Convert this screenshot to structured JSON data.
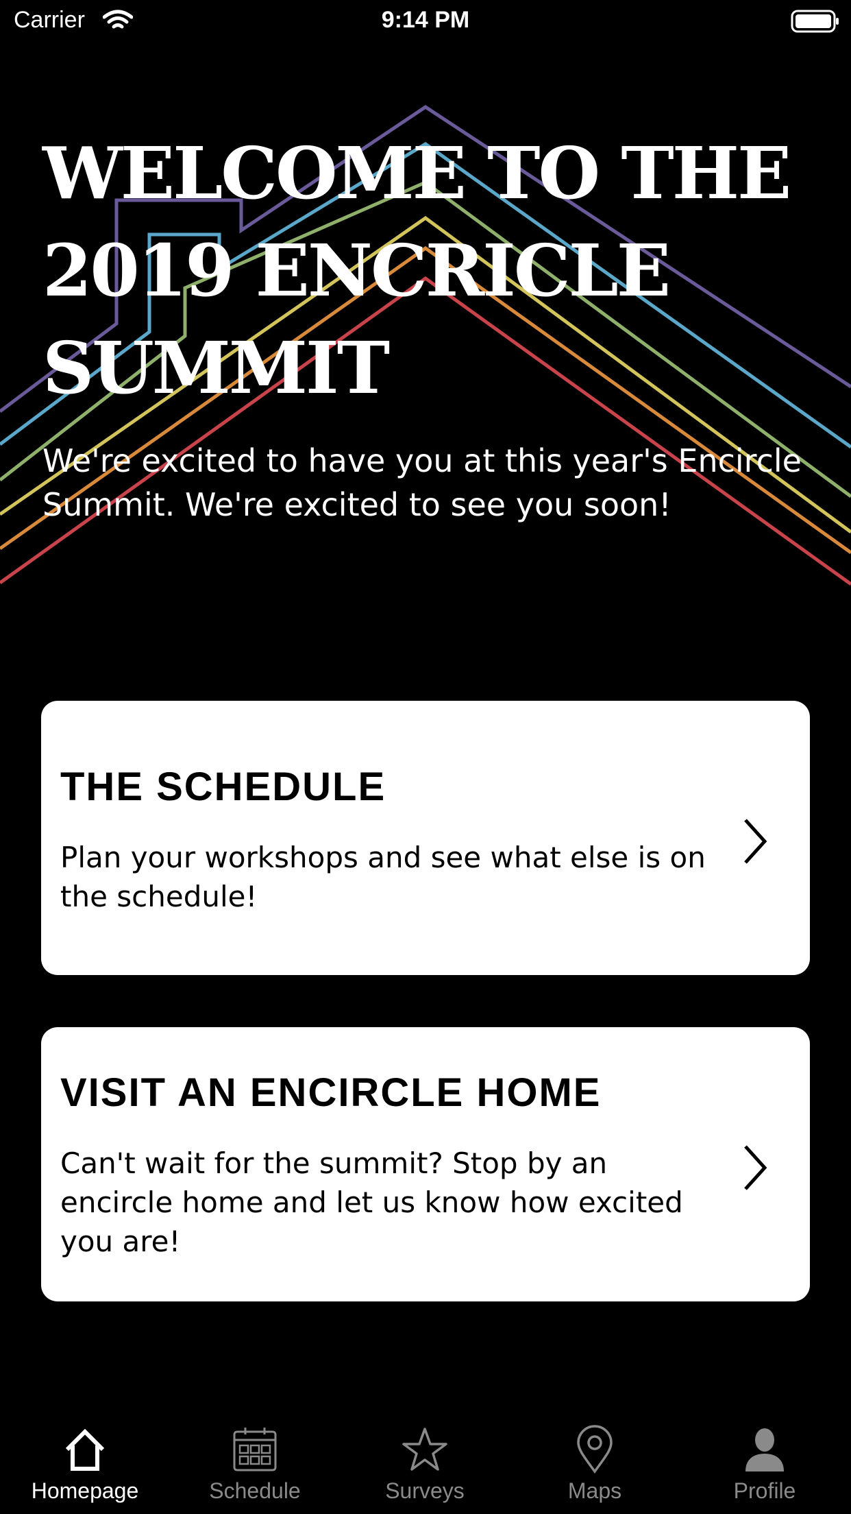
{
  "status_bar": {
    "carrier": "Carrier",
    "time": "9:14 PM"
  },
  "hero": {
    "title": "WELCOME TO THE 2019 ENCRICLE SUMMIT",
    "subtitle": "We're excited to have you at this year's Encircle Summit. We're excited to see you soon!",
    "stripe_colors": [
      "#6a5a9a",
      "#5aa7c9",
      "#8eb06a",
      "#d2c45a",
      "#d88a3a",
      "#c9434a"
    ]
  },
  "cards": [
    {
      "title": "THE SCHEDULE",
      "description": "Plan  your workshops and see what else is on the schedule!"
    },
    {
      "title": "VISIT AN ENCIRCLE HOME",
      "description": "Can't wait for the summit? Stop by an encircle home and let us know how excited you are!"
    }
  ],
  "tab_bar": {
    "active_color": "#ffffff",
    "inactive_color": "#8a8a8a",
    "tabs": [
      {
        "label": "Homepage",
        "icon": "home-icon",
        "active": true
      },
      {
        "label": "Schedule",
        "icon": "calendar-icon",
        "active": false
      },
      {
        "label": "Surveys",
        "icon": "star-icon",
        "active": false
      },
      {
        "label": "Maps",
        "icon": "map-pin-icon",
        "active": false
      },
      {
        "label": "Profile",
        "icon": "person-icon",
        "active": false
      }
    ]
  }
}
